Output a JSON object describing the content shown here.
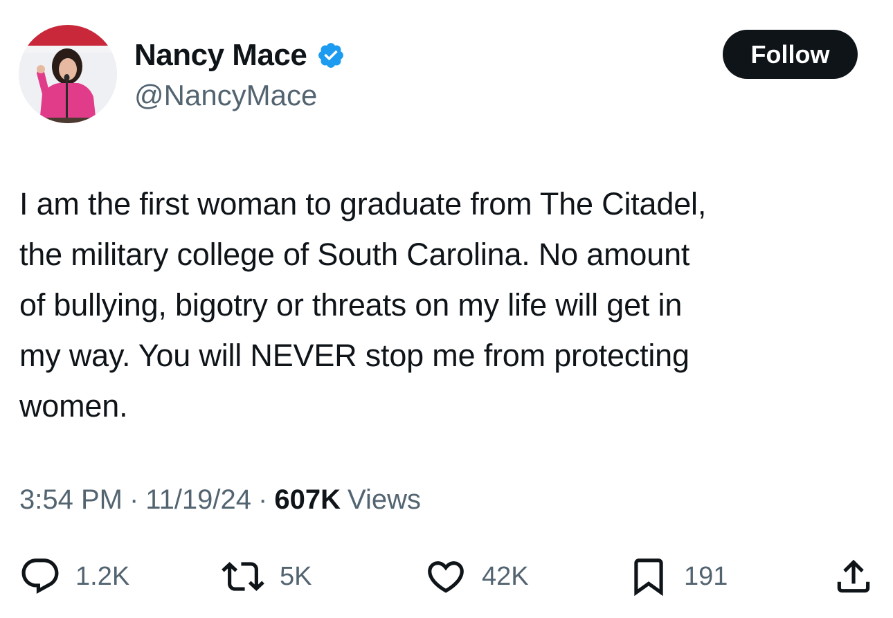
{
  "author": {
    "display_name": "Nancy Mace",
    "handle": "@NancyMace",
    "avatar_icon": "profile-photo",
    "verified_icon": "verified-badge-icon"
  },
  "follow_button": {
    "label": "Follow"
  },
  "tweet": {
    "text_lines": [
      "I am the first woman to graduate from The Citadel,",
      "the military college of South Carolina. No amount",
      "of bullying, bigotry or threats on my life will get in",
      "my way. You will NEVER stop me from protecting",
      "women."
    ]
  },
  "meta": {
    "time": "3:54 PM",
    "separator": "·",
    "date": "11/19/24",
    "views_count": "607K",
    "views_label": "Views"
  },
  "actions": {
    "reply": {
      "icon": "reply-icon",
      "count": "1.2K"
    },
    "repost": {
      "icon": "repost-icon",
      "count": "5K"
    },
    "like": {
      "icon": "heart-icon",
      "count": "42K"
    },
    "bookmark": {
      "icon": "bookmark-icon",
      "count": "191"
    },
    "share": {
      "icon": "share-icon"
    }
  },
  "colors": {
    "text_primary": "#0f1419",
    "text_secondary": "#536471",
    "verified_blue": "#1d9bf0",
    "follow_bg": "#0f1419",
    "background": "#ffffff"
  }
}
